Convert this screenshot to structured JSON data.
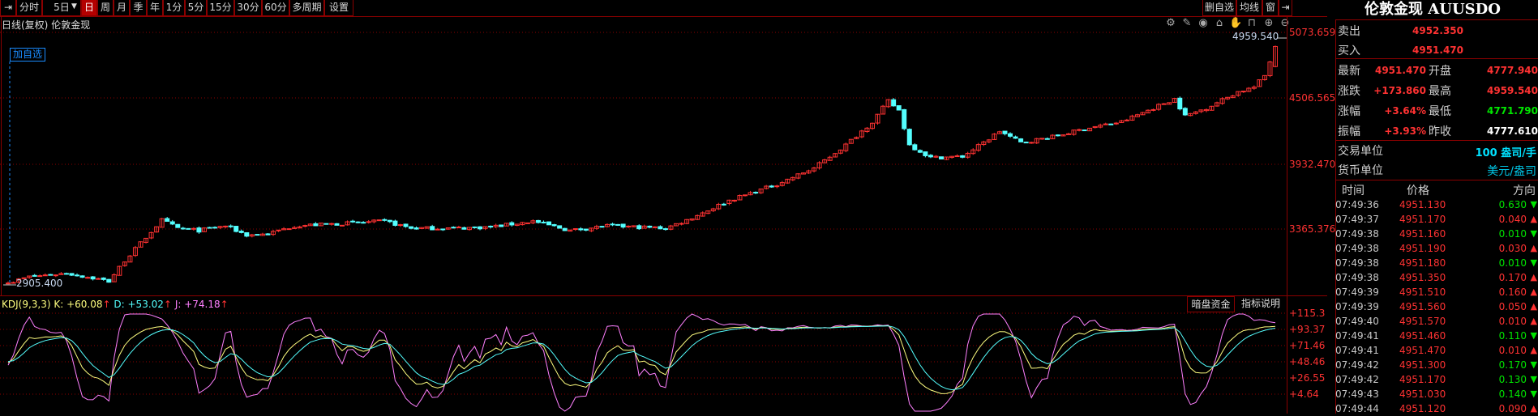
{
  "toolbar": {
    "items": [
      "分时",
      "5日",
      "日",
      "周",
      "月",
      "季",
      "年",
      "1分",
      "5分",
      "15分",
      "30分",
      "60分",
      "多周期",
      "设置"
    ],
    "active": "日",
    "right": [
      "删自选",
      "均线",
      "窗"
    ]
  },
  "chart_header": {
    "mode": "日线(复权)",
    "name": "伦敦金现",
    "add_watch": "加自选"
  },
  "chart_icons": [
    "gear-icon",
    "pen-icon",
    "eye-icon",
    "toolbox-icon",
    "hand-icon",
    "lock-icon",
    "zoom-in-icon",
    "zoom-out-icon"
  ],
  "kdj": {
    "title": "KDJ(9,3,3)",
    "k": "K: +60.08",
    "d": "D: +53.02",
    "j": "J: +74.18",
    "btn1": "暗盘资金",
    "btn2": "指标说明"
  },
  "quote": {
    "title": "伦敦金现 AUUSDO",
    "sell_label": "卖出",
    "sell": "4952.350",
    "buy_label": "买入",
    "buy": "4951.470",
    "latest_label": "最新",
    "latest": "4951.470",
    "open_label": "开盘",
    "open": "4777.940",
    "change_label": "涨跌",
    "change": "+173.860",
    "high_label": "最高",
    "high": "4959.540",
    "pct_label": "涨幅",
    "pct": "+3.64%",
    "low_label": "最低",
    "low": "4771.790",
    "amp_label": "振幅",
    "amp": "+3.93%",
    "prev_label": "昨收",
    "prev": "4777.610",
    "unit_label": "交易单位",
    "unit": "100 盎司/手",
    "currency_label": "货币单位",
    "currency": "美元/盎司"
  },
  "ticks_header": {
    "time": "时间",
    "price": "价格",
    "dir": "方向"
  },
  "ticks": [
    {
      "t": "07:49:36",
      "p": "4951.130",
      "c": "0.630",
      "up": false
    },
    {
      "t": "07:49:37",
      "p": "4951.170",
      "c": "0.040",
      "up": true
    },
    {
      "t": "07:49:38",
      "p": "4951.160",
      "c": "0.010",
      "up": false
    },
    {
      "t": "07:49:38",
      "p": "4951.190",
      "c": "0.030",
      "up": true
    },
    {
      "t": "07:49:38",
      "p": "4951.180",
      "c": "0.010",
      "up": false
    },
    {
      "t": "07:49:38",
      "p": "4951.350",
      "c": "0.170",
      "up": true
    },
    {
      "t": "07:49:39",
      "p": "4951.510",
      "c": "0.160",
      "up": true
    },
    {
      "t": "07:49:39",
      "p": "4951.560",
      "c": "0.050",
      "up": true
    },
    {
      "t": "07:49:40",
      "p": "4951.570",
      "c": "0.010",
      "up": true
    },
    {
      "t": "07:49:41",
      "p": "4951.460",
      "c": "0.110",
      "up": false
    },
    {
      "t": "07:49:41",
      "p": "4951.470",
      "c": "0.010",
      "up": true
    },
    {
      "t": "07:49:42",
      "p": "4951.300",
      "c": "0.170",
      "up": false
    },
    {
      "t": "07:49:42",
      "p": "4951.170",
      "c": "0.130",
      "up": false
    },
    {
      "t": "07:49:43",
      "p": "4951.030",
      "c": "0.140",
      "up": false
    },
    {
      "t": "07:49:44",
      "p": "4951.120",
      "c": "0.090",
      "up": true
    }
  ],
  "colors": {
    "up": "#ff3232",
    "down": "#54ffff",
    "k": "#ffff80",
    "d": "#54ffff",
    "j": "#ff80ff"
  },
  "chart_data": {
    "type": "candlestick",
    "y_ticks": [
      "5073.659",
      "4506.565",
      "3932.470",
      "3365.376"
    ],
    "ylim": [
      2905.4,
      5073.659
    ],
    "max_label": "4959.540",
    "min_label": "2905.400",
    "candle_count": 240,
    "close_anchors": [
      [
        0,
        2905
      ],
      [
        4,
        2960
      ],
      [
        11,
        2990
      ],
      [
        17,
        2940
      ],
      [
        19,
        2920
      ],
      [
        22,
        3100
      ],
      [
        26,
        3300
      ],
      [
        29,
        3450
      ],
      [
        32,
        3380
      ],
      [
        36,
        3360
      ],
      [
        41,
        3400
      ],
      [
        45,
        3320
      ],
      [
        49,
        3330
      ],
      [
        54,
        3400
      ],
      [
        63,
        3420
      ],
      [
        71,
        3440
      ],
      [
        76,
        3380
      ],
      [
        84,
        3380
      ],
      [
        91,
        3390
      ],
      [
        99,
        3440
      ],
      [
        106,
        3360
      ],
      [
        113,
        3400
      ],
      [
        124,
        3380
      ],
      [
        128,
        3450
      ],
      [
        136,
        3620
      ],
      [
        145,
        3760
      ],
      [
        152,
        3900
      ],
      [
        158,
        4100
      ],
      [
        163,
        4300
      ],
      [
        166,
        4480
      ],
      [
        168,
        4400
      ],
      [
        170,
        4100
      ],
      [
        174,
        3990
      ],
      [
        180,
        4000
      ],
      [
        184,
        4120
      ],
      [
        187,
        4220
      ],
      [
        191,
        4120
      ],
      [
        197,
        4170
      ],
      [
        204,
        4250
      ],
      [
        210,
        4300
      ],
      [
        215,
        4400
      ],
      [
        220,
        4500
      ],
      [
        222,
        4350
      ],
      [
        226,
        4420
      ],
      [
        232,
        4560
      ],
      [
        235,
        4600
      ],
      [
        237,
        4700
      ],
      [
        239,
        4951.47
      ]
    ],
    "last_candle": {
      "open": 4777.94,
      "high": 4959.54,
      "low": 4771.79,
      "close": 4951.47
    },
    "kdj_ticks": [
      "+115.3",
      "+93.37",
      "+71.46",
      "+48.46",
      "+26.55",
      "+4.64"
    ],
    "kdj_range": [
      4.64,
      115.3
    ]
  }
}
